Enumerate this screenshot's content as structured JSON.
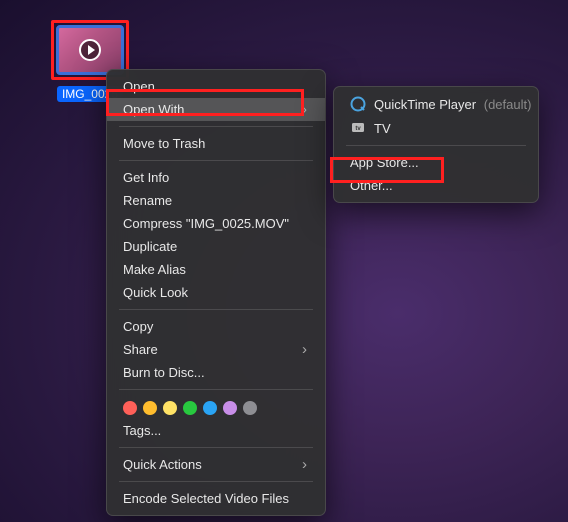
{
  "file": {
    "label": "IMG_0025"
  },
  "menu": {
    "open": "Open",
    "open_with": "Open With",
    "move_to_trash": "Move to Trash",
    "get_info": "Get Info",
    "rename": "Rename",
    "compress": "Compress \"IMG_0025.MOV\"",
    "duplicate": "Duplicate",
    "make_alias": "Make Alias",
    "quick_look": "Quick Look",
    "copy": "Copy",
    "share": "Share",
    "burn": "Burn to Disc...",
    "tags": "Tags...",
    "quick_actions": "Quick Actions",
    "encode": "Encode Selected Video Files"
  },
  "submenu": {
    "quicktime": "QuickTime Player",
    "default_suffix": "(default)",
    "tv": "TV",
    "app_store": "App Store...",
    "other": "Other..."
  },
  "tag_colors": [
    "#ff6059",
    "#ffbd2e",
    "#ffe266",
    "#28c93f",
    "#2aa4f4",
    "#c88ee8",
    "#8e8e93"
  ]
}
